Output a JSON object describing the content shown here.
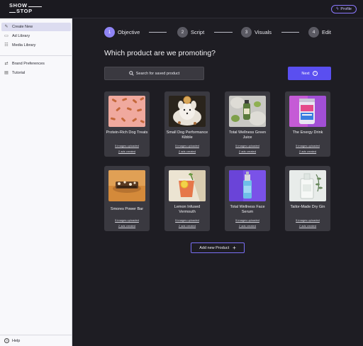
{
  "app": {
    "logo_line1": "SHOW",
    "logo_line2": "STOP",
    "profile_label": "Profile",
    "accent_color": "#5a4ff0"
  },
  "sidebar": {
    "items": [
      {
        "label": "Create New",
        "icon": "sparkle-icon",
        "active": true
      },
      {
        "label": "Ad Library",
        "icon": "folder-icon",
        "active": false
      },
      {
        "label": "Media Library",
        "icon": "media-icon",
        "active": false
      },
      {
        "label": "Brand Preferences",
        "icon": "preferences-icon",
        "active": false
      },
      {
        "label": "Tutorial",
        "icon": "document-icon",
        "active": false
      }
    ],
    "help_label": "Help"
  },
  "steps": [
    {
      "num": "1",
      "label": "Objective",
      "active": true
    },
    {
      "num": "2",
      "label": "Script",
      "active": false
    },
    {
      "num": "3",
      "label": "Visuals",
      "active": false
    },
    {
      "num": "4",
      "label": "Edit",
      "active": false
    }
  ],
  "main": {
    "question": "Which product are we promoting?",
    "search_label": "Search for saved product",
    "next_label": "Next",
    "add_label": "Add new Product"
  },
  "products": [
    {
      "name": "Protein-Rich Dog Treats",
      "images": "5 images uploaded",
      "ads": "2 ads created"
    },
    {
      "name": "Small Dog Performance Kibble",
      "images": "5 images uploaded",
      "ads": "2 ads created"
    },
    {
      "name": "Total Wellness Green Juice",
      "images": "5 images uploaded",
      "ads": "2 ads created"
    },
    {
      "name": "The Energy Drink",
      "images": "5 images uploaded",
      "ads": "2 ads created"
    },
    {
      "name": "Smores Power Bar",
      "images": "5 images uploaded",
      "ads": "2 ads created"
    },
    {
      "name": "Lemon Infused Vermouth",
      "images": "5 images uploaded",
      "ads": "2 ads created"
    },
    {
      "name": "Total Wellness Face Serum",
      "images": "5 images uploaded",
      "ads": "2 ads created"
    },
    {
      "name": "Tailor-Made Dry Gin",
      "images": "5 images uploaded",
      "ads": "2 ads created"
    }
  ]
}
